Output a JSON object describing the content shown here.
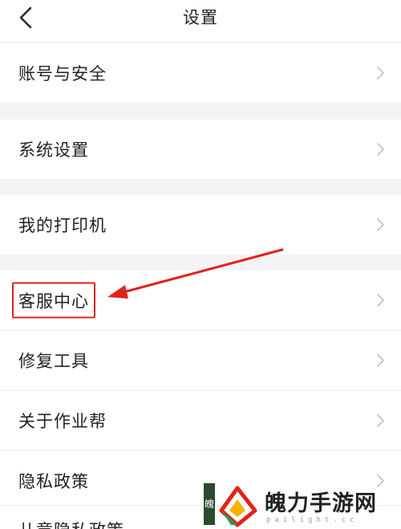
{
  "header": {
    "title": "设置"
  },
  "rows": [
    {
      "label": "账号与安全"
    },
    {
      "label": "系统设置"
    },
    {
      "label": "我的打印机"
    },
    {
      "label": "客服中心"
    },
    {
      "label": "修复工具"
    },
    {
      "label": "关于作业帮"
    },
    {
      "label": "隐私政策"
    },
    {
      "label": "儿童隐私政策"
    }
  ],
  "watermark": {
    "brand": "魄力手游网",
    "domain": "pailight.cc"
  },
  "colors": {
    "background": "#f4f4f6",
    "row_background": "#ffffff",
    "annotation_red": "#e0241c",
    "chevron": "#c4c4c4"
  }
}
